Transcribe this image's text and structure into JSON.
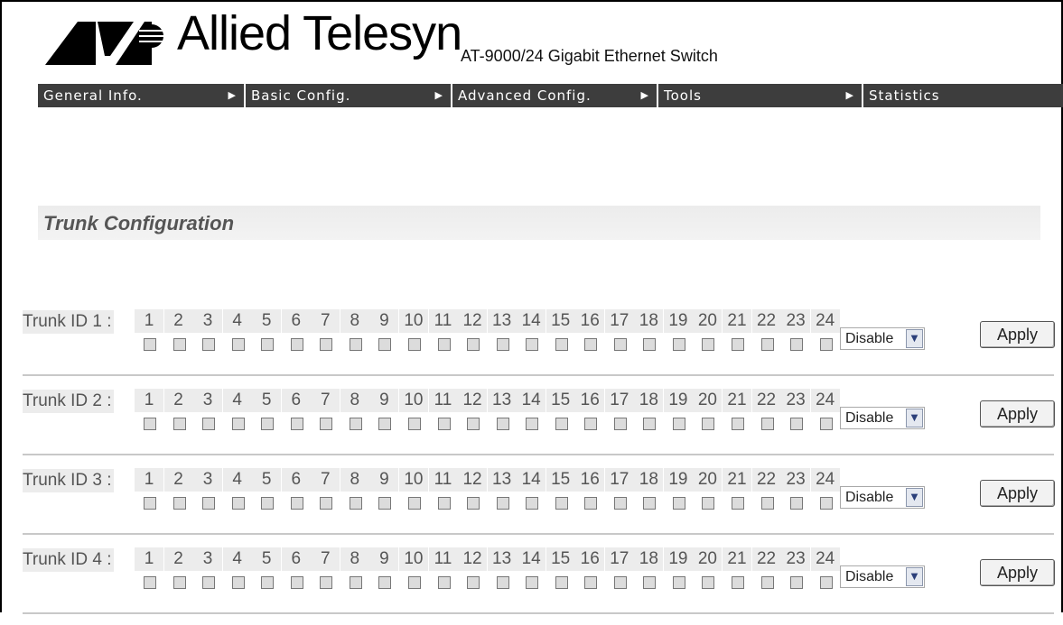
{
  "header": {
    "brand": "Allied Telesyn",
    "product": "AT-9000/24 Gigabit Ethernet Switch",
    "logo_icon": "allied-telesyn-logo-icon"
  },
  "nav": {
    "items": [
      {
        "label": "General Info.",
        "has_arrow": true
      },
      {
        "label": "Basic Config.",
        "has_arrow": true
      },
      {
        "label": "Advanced Config.",
        "has_arrow": true
      },
      {
        "label": "Tools",
        "has_arrow": true
      },
      {
        "label": "Statistics",
        "has_arrow": false
      }
    ],
    "arrow_glyph": "▶"
  },
  "page": {
    "title": "Trunk Configuration"
  },
  "trunks": [
    {
      "label": "Trunk ID 1 :",
      "mode": "Disable",
      "apply": "Apply"
    },
    {
      "label": "Trunk ID 2 :",
      "mode": "Disable",
      "apply": "Apply"
    },
    {
      "label": "Trunk ID 3 :",
      "mode": "Disable",
      "apply": "Apply"
    },
    {
      "label": "Trunk ID 4 :",
      "mode": "Disable",
      "apply": "Apply"
    }
  ],
  "ports": [
    "1",
    "2",
    "3",
    "4",
    "5",
    "6",
    "7",
    "8",
    "9",
    "10",
    "11",
    "12",
    "13",
    "14",
    "15",
    "16",
    "17",
    "18",
    "19",
    "20",
    "21",
    "22",
    "23",
    "24"
  ],
  "select_arrow_glyph": "▼",
  "colors": {
    "navbar": "#3d3d3d",
    "title_band": "#ececec",
    "divider": "#c8c8c8"
  }
}
